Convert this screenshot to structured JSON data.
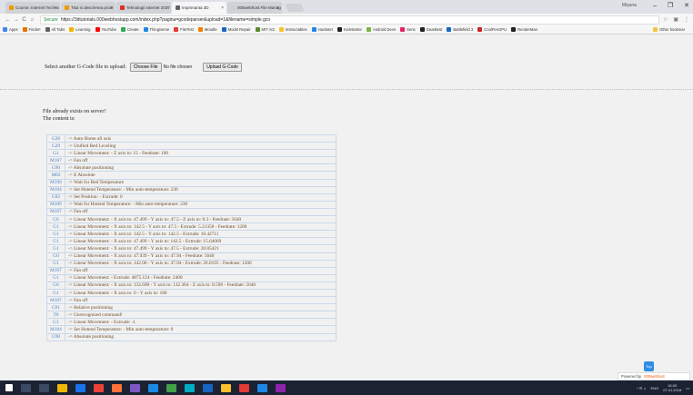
{
  "browser": {
    "tabs": [
      {
        "title": "Course: Internet Techno",
        "active": false,
        "color": "#f29900"
      },
      {
        "title": "Titul si descrierea proie",
        "active": false,
        "color": "#f29900"
      },
      {
        "title": "Tehnologii internet 2017",
        "active": false,
        "color": "#d93025"
      },
      {
        "title": "Imprimanta 3D",
        "active": true,
        "color": "#5f6368"
      },
      {
        "title": "000webhost File Manag",
        "active": false,
        "color": "#cfcfcf"
      }
    ],
    "profile_name": "Mișuna",
    "window_controls": {
      "minimize": "–",
      "maximize": "❐",
      "close": "✕"
    },
    "nav": {
      "back": "←",
      "forward": "→",
      "reload": "C",
      "home": "⌂"
    },
    "secure_label": "Secure",
    "url": "https://3dtutorials.000webhostapp.com/index.php?pagina=gcodeparser&upload=1&filename=simple.gco",
    "bookmarks": [
      {
        "label": "Apps",
        "color": "#4285f4"
      },
      {
        "label": "Finder!",
        "color": "#e37400"
      },
      {
        "label": "All Tabs",
        "color": "#5f6368"
      },
      {
        "label": "Learning",
        "color": "#f4b400"
      },
      {
        "label": "YouTube",
        "color": "#ff0000"
      },
      {
        "label": "Create",
        "color": "#34a853"
      },
      {
        "label": "Thingiverse",
        "color": "#1e88e5"
      },
      {
        "label": "FiteTest",
        "color": "#e53935"
      },
      {
        "label": "Moodle",
        "color": "#f57c00"
      },
      {
        "label": "Model Repair",
        "color": "#1565c0"
      },
      {
        "label": "MIT AI2",
        "color": "#558b2f"
      },
      {
        "label": "Instructables",
        "color": "#fbc02d"
      },
      {
        "label": "Hackster",
        "color": "#1e88e5"
      },
      {
        "label": "Kickstarter",
        "color": "#212121"
      },
      {
        "label": "Android Devs",
        "color": "#7cb342"
      },
      {
        "label": "Sens",
        "color": "#e91e63"
      },
      {
        "label": "GearBest",
        "color": "#212121"
      },
      {
        "label": "Battlefield 3",
        "color": "#1565c0"
      },
      {
        "label": "CoolFireGPU",
        "color": "#c62828"
      },
      {
        "label": "RenderMan",
        "color": "#212121"
      }
    ],
    "other_bookmarks": "Other bookmar"
  },
  "page": {
    "upload_label": "Select another G-Code file to upload:",
    "choose_file_button": "Choose File",
    "no_file_text": "No file chosen",
    "upload_button": "Upload G-Code",
    "message_line1": "File already exists on server!",
    "message_line2": "The content is:",
    "gcode_rows": [
      {
        "cmd": "G28",
        "desc": "-> Auto Home all axis"
      },
      {
        "cmd": "G29",
        "desc": "-> Unified Bed Leveling"
      },
      {
        "cmd": "G1",
        "desc": "-> Linear Movement: - Z axis to: 15 - Feedrate: 100"
      },
      {
        "cmd": "M107",
        "desc": "-> Fan off"
      },
      {
        "cmd": "G90",
        "desc": "-> Absolute positioning"
      },
      {
        "cmd": "M82",
        "desc": "-> E Absolute"
      },
      {
        "cmd": "M190",
        "desc": "-> Wait for Bed Temperature"
      },
      {
        "cmd": "M104",
        "desc": "-> Set Hotend Temperature: - Min auto-temperature: 230"
      },
      {
        "cmd": "G92",
        "desc": "-> Set Position: - Extrude: 0"
      },
      {
        "cmd": "M109",
        "desc": "-> Wait for Hotend Temperature: - Min auto-temperature: 230"
      },
      {
        "cmd": "M107",
        "desc": "-> Fan off"
      },
      {
        "cmd": "G0",
        "desc": "-> Linear Movement: - X axis to: 47.499 - Y axis to: 47.5 - Z axis to: 0.3 - Feedrate: 5640"
      },
      {
        "cmd": "G1",
        "desc": "-> Linear Movement: - X axis to: 142.5 - Y axis to: 47.5 - Extrude: 5.21358 - Feedrate: 1200"
      },
      {
        "cmd": "G1",
        "desc": "-> Linear Movement: - X axis to: 142.5 - Y axis to: 142.5 - Extrude: 10.42711"
      },
      {
        "cmd": "G1",
        "desc": "-> Linear Movement: - X axis to: 47.499 - Y axis to: 142.5 - Extrude: 15.64069"
      },
      {
        "cmd": "G1",
        "desc": "-> Linear Movement: - X axis to: 47.499 - Y axis to: 47.5 - Extrude: 20.85421"
      },
      {
        "cmd": "G0",
        "desc": "-> Linear Movement: - X axis to: 47.939 - Y axis to: 47.94 - Feedrate: 5640"
      },
      {
        "cmd": "G1",
        "desc": "-> Linear Movement: - X axis to: 142.06 - Y axis to: 47.94 - Extrude: 26.0195 - Feedrate: 1200"
      },
      {
        "cmd": "M107",
        "desc": "-> Fan off"
      },
      {
        "cmd": "G1",
        "desc": "-> Linear Movement: - Extrude: 4875.124 - Feedrate: 2400"
      },
      {
        "cmd": "G0",
        "desc": "-> Linear Movement: - X axis to: 132.698 - Y axis to: 132.364 - Z axis to: 8.599 - Feedrate: 5640"
      },
      {
        "cmd": "G1",
        "desc": "-> Linear Movement: - X axis to: 0 - Y axis to: 180"
      },
      {
        "cmd": "M107",
        "desc": "-> Fan off"
      },
      {
        "cmd": "G91",
        "desc": "-> Relative positioning"
      },
      {
        "cmd": "T0",
        "desc": "-> Unrecognized command!"
      },
      {
        "cmd": "G1",
        "desc": "-> Linear Movement: - Extrude: -1"
      },
      {
        "cmd": "M104",
        "desc": "-> Set Hotend Temperature: - Min auto-temperature: 0"
      },
      {
        "cmd": "G90",
        "desc": "-> Absolute positioning"
      }
    ],
    "top_button": "Top",
    "powered_by": "Powered by",
    "powered_brand": "000webhost"
  },
  "taskbar": {
    "items": [
      {
        "name": "search-taskbar-icon",
        "color": "#3b4a63"
      },
      {
        "name": "task-view-taskbar-icon",
        "color": "#3b4a63"
      },
      {
        "name": "file-explorer-taskbar-icon",
        "color": "#f2b705"
      },
      {
        "name": "edge-taskbar-icon",
        "color": "#1a73e8"
      },
      {
        "name": "chrome-taskbar-icon",
        "color": "#ea4335"
      },
      {
        "name": "firefox-taskbar-icon",
        "color": "#ff7139"
      },
      {
        "name": "visual-studio-taskbar-icon",
        "color": "#7e57c2"
      },
      {
        "name": "app-taskbar-icon",
        "color": "#1e88e5"
      },
      {
        "name": "app2-taskbar-icon",
        "color": "#43a047"
      },
      {
        "name": "app3-taskbar-icon",
        "color": "#00acc1"
      },
      {
        "name": "app4-taskbar-icon",
        "color": "#1565c0"
      },
      {
        "name": "app5-taskbar-icon",
        "color": "#fbc02d"
      },
      {
        "name": "app6-taskbar-icon",
        "color": "#e53935"
      },
      {
        "name": "app7-taskbar-icon",
        "color": "#1e88e5"
      },
      {
        "name": "app8-taskbar-icon",
        "color": "#8e24aa"
      }
    ],
    "language": "ENG",
    "time": "16:05",
    "date": "07.01.2018"
  }
}
